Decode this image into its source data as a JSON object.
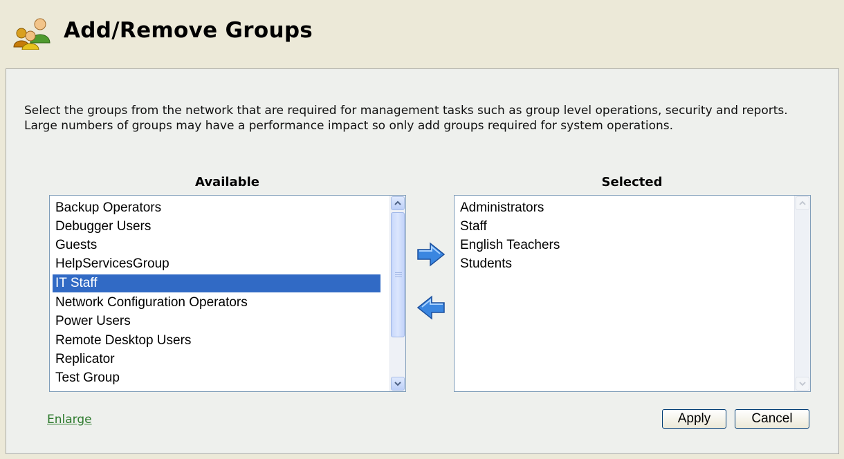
{
  "header": {
    "title": "Add/Remove Groups",
    "icon": "user-group-icon"
  },
  "panel": {
    "description": "Select the groups from the network that are required for management tasks such as group level operations, security and reports. Large numbers of groups may have a performance impact so only add groups required for system operations.",
    "available_label": "Available",
    "selected_label": "Selected",
    "available_items": [
      "Backup Operators",
      "Debugger Users",
      "Guests",
      "HelpServicesGroup",
      "IT Staff",
      "Network Configuration Operators",
      "Power Users",
      "Remote Desktop Users",
      "Replicator",
      "Test Group"
    ],
    "available_selected_item": "IT Staff",
    "selected_items": [
      "Administrators",
      "Staff",
      "English Teachers",
      "Students"
    ],
    "add_icon": "arrow-right-icon",
    "remove_icon": "arrow-left-icon",
    "enlarge_label": "Enlarge",
    "apply_label": "Apply",
    "cancel_label": "Cancel"
  },
  "colors": {
    "selection": "#316ac5",
    "link": "#2d7a2d",
    "arrow": "#3a86e0"
  }
}
